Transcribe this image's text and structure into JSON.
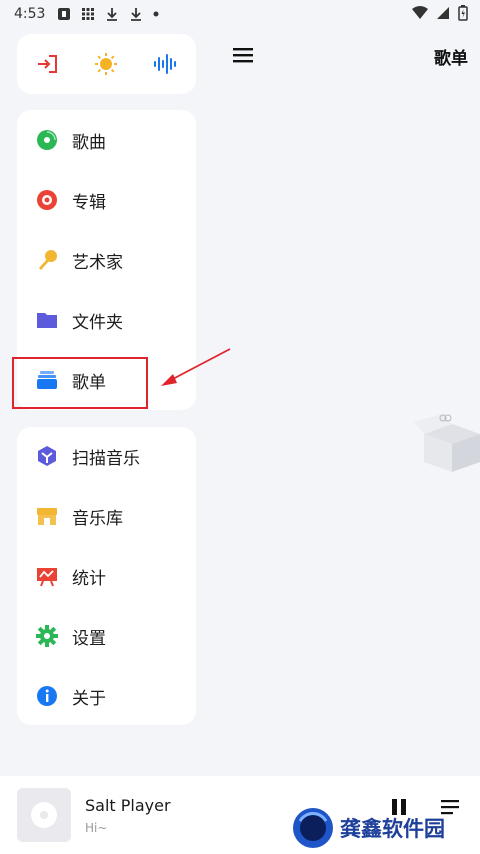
{
  "status": {
    "time": "4:53"
  },
  "header": {
    "title": "歌单"
  },
  "library_menu": [
    {
      "label": "歌曲",
      "icon": "disc-icon",
      "color": "#2bb756"
    },
    {
      "label": "专辑",
      "icon": "album-icon",
      "color": "#ea4335"
    },
    {
      "label": "艺术家",
      "icon": "microphone-icon",
      "color": "#f2b632"
    },
    {
      "label": "文件夹",
      "icon": "folder-icon",
      "color": "#5c5bdc"
    },
    {
      "label": "歌单",
      "icon": "playlist-icon",
      "color": "#1877f2"
    }
  ],
  "tools_menu": [
    {
      "label": "扫描音乐",
      "icon": "scan-icon",
      "color": "#5c5bdc"
    },
    {
      "label": "音乐库",
      "icon": "store-icon",
      "color": "#f2b632"
    },
    {
      "label": "统计",
      "icon": "stats-icon",
      "color": "#ea4335"
    },
    {
      "label": "设置",
      "icon": "settings-icon",
      "color": "#2bb756"
    },
    {
      "label": "关于",
      "icon": "info-icon",
      "color": "#1877f2"
    }
  ],
  "player": {
    "title": "Salt Player",
    "subtitle": "Hi~"
  },
  "watermark": {
    "text": "龚鑫软件园"
  }
}
